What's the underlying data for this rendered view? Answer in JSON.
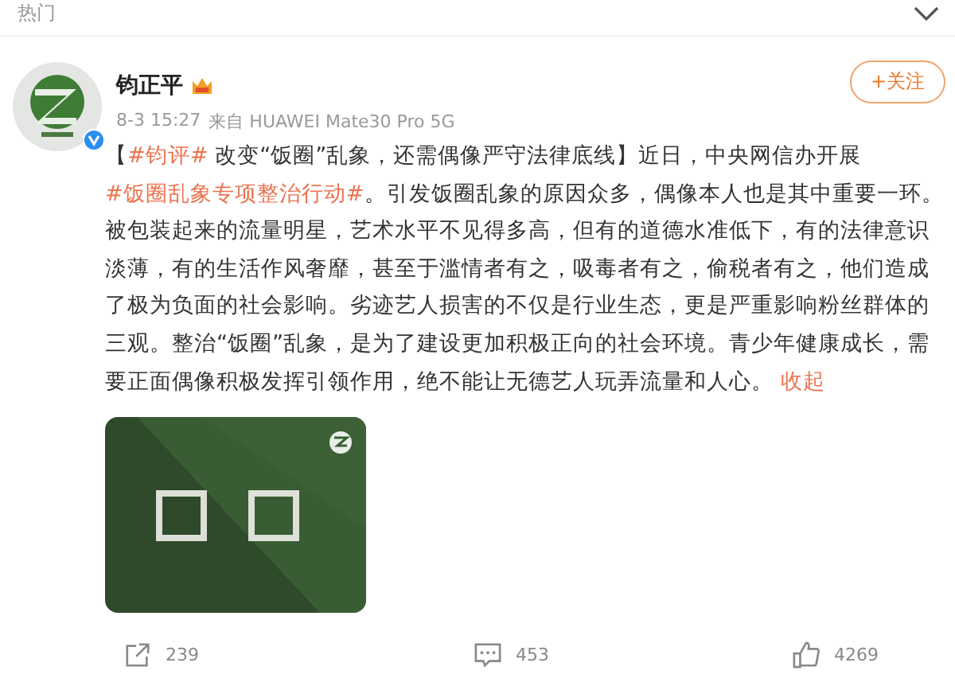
{
  "section_header": {
    "title": "热门",
    "expanded": true
  },
  "post": {
    "author": "钧正平",
    "verified": true,
    "timestamp": "8-3 15:27",
    "source": "来自 HUAWEI Mate30 Pro 5G",
    "follow_label": "+关注",
    "body": [
      {
        "kind": "text",
        "text": "【"
      },
      {
        "kind": "hashtag",
        "text": "#钧评#"
      },
      {
        "kind": "text",
        "text": " 改变“饭圈”乱象，还需偶像严守法律底线】近日，中央网信办开展"
      },
      {
        "kind": "hashtag",
        "text": "#饭圈乱象专项整治行动#"
      },
      {
        "kind": "text",
        "text": "。引发饭圈乱象的原因众多，偶像本人也是其中重要一环。被包装起来的流量明星，艺术水平不见得多高，但有的道德水准低下，有的法律意识淡薄，有的生活作风奢靡，甚至于滥情者有之，吸毒者有之，偷税者有之，他们造成了极为负面的社会影响。劣迹艺人损害的不仅是行业生态，更是严重影响粉丝群体的三观。整治“饭圈”乱象，是为了建设更加积极正向的社会环境。青少年健康成长，需要正面偶像积极发挥引领作用，绝不能让无德艺人玩弄流量和人心。 "
      },
      {
        "kind": "collapse",
        "text": "收起"
      }
    ],
    "actions": [
      {
        "kind": "repost",
        "count": "239"
      },
      {
        "kind": "comment",
        "count": "453"
      },
      {
        "kind": "like",
        "count": "4269"
      }
    ]
  }
}
